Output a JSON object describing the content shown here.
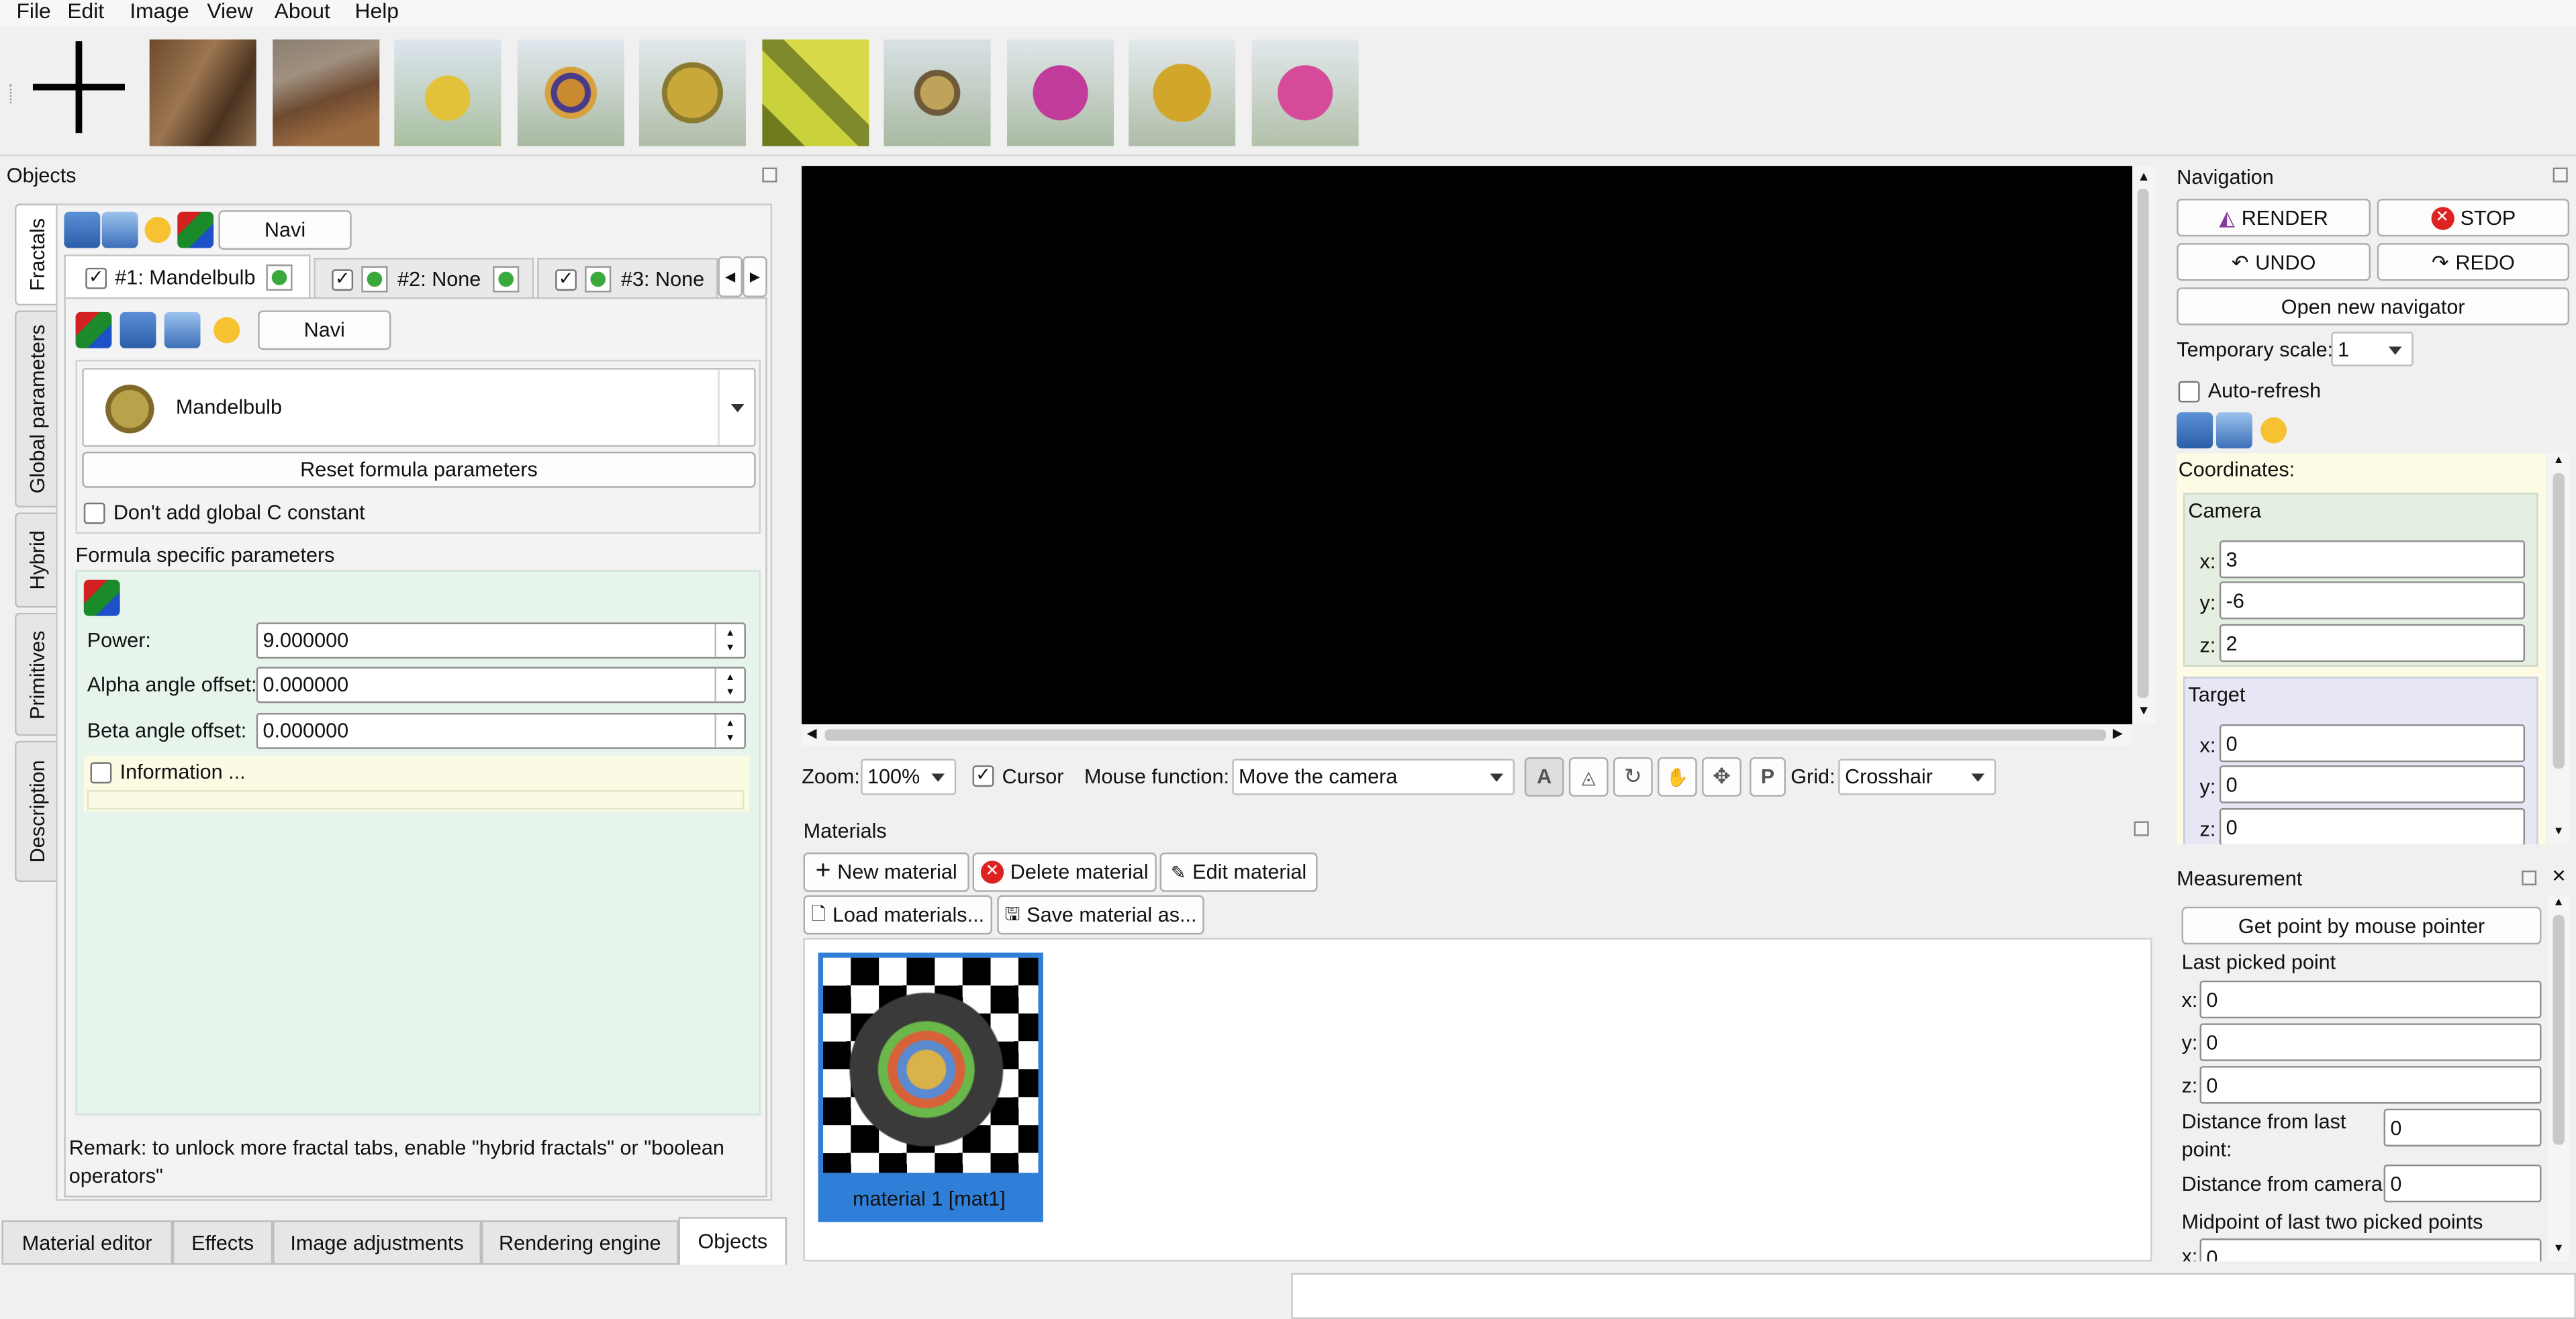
{
  "menu": [
    "File",
    "Edit",
    "Image",
    "View",
    "About",
    "Help"
  ],
  "objects_panel": {
    "title": "Objects",
    "vertical_tabs": [
      "Fractals",
      "Global parameters",
      "Hybrid",
      "Primitives",
      "Description"
    ],
    "navi_label": "Navi",
    "fractal_tabs": [
      "#1: Mandelbulb",
      "#2: None",
      "#3: None"
    ],
    "formula_name": "Mandelbulb",
    "reset_label": "Reset formula parameters",
    "dont_add_c": "Don't add global C constant",
    "formula_section": "Formula specific parameters",
    "params": [
      {
        "label": "Power:",
        "value": "9.000000"
      },
      {
        "label": "Alpha angle offset:",
        "value": "0.000000"
      },
      {
        "label": "Beta angle offset:",
        "value": "0.000000"
      }
    ],
    "information": "Information ...",
    "remark": "Remark: to unlock more fractal tabs, enable \"hybrid fractals\" or \"boolean operators\""
  },
  "bottom_tabs": [
    "Material editor",
    "Effects",
    "Image adjustments",
    "Rendering engine",
    "Objects"
  ],
  "toolbar": {
    "zoom_label": "Zoom:",
    "zoom_value": "100%",
    "cursor_label": "Cursor",
    "mouse_function_label": "Mouse function:",
    "mouse_function_value": "Move the camera",
    "grid_label": "Grid:",
    "grid_value": "Crosshair"
  },
  "materials": {
    "title": "Materials",
    "new": "New material",
    "delete": "Delete material",
    "edit": "Edit material",
    "load": "Load materials...",
    "save": "Save material as...",
    "item_label": "material 1 [mat1]"
  },
  "navigation": {
    "title": "Navigation",
    "render": "RENDER",
    "stop": "STOP",
    "undo": "UNDO",
    "redo": "REDO",
    "open_navigator": "Open new navigator",
    "temp_scale_label": "Temporary scale:",
    "temp_scale_value": "1",
    "auto_refresh": "Auto-refresh",
    "coordinates": "Coordinates:",
    "camera_title": "Camera",
    "camera": [
      {
        "axis": "x:",
        "value": "3"
      },
      {
        "axis": "y:",
        "value": "-6"
      },
      {
        "axis": "z:",
        "value": "2"
      }
    ],
    "target_title": "Target",
    "target": [
      {
        "axis": "x:",
        "value": "0"
      },
      {
        "axis": "y:",
        "value": "0"
      },
      {
        "axis": "z:",
        "value": "0"
      }
    ]
  },
  "measurement": {
    "title": "Measurement",
    "get_point": "Get point by mouse pointer",
    "last_picked": "Last picked point",
    "point": [
      {
        "axis": "x:",
        "value": "0"
      },
      {
        "axis": "y:",
        "value": "0"
      },
      {
        "axis": "z:",
        "value": "0"
      }
    ],
    "dist_last_label": "Distance from last point:",
    "dist_last_value": "0",
    "dist_camera_label": "Distance from camera:",
    "dist_camera_value": "0",
    "midpoint_label": "Midpoint of last two picked points",
    "midpoint_x_axis": "x:",
    "midpoint_x_value": "0"
  },
  "colors": {
    "accent": "#2f7fd8",
    "render_area": "#000000",
    "formula_bg": "#e6f4ec",
    "coords_bg": "#fdfbe3",
    "camera_bg": "#e5efe1",
    "target_bg": "#e6e6f5",
    "info_bg": "#fbfbe4"
  }
}
